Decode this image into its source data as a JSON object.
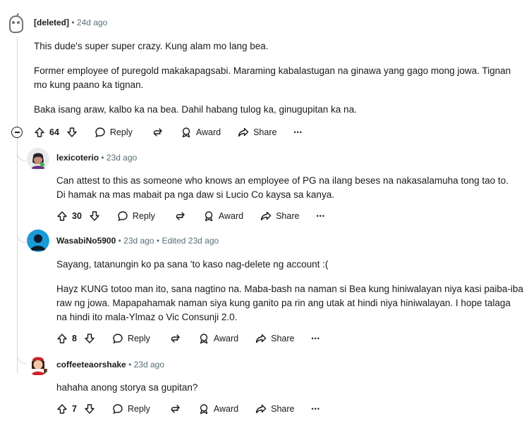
{
  "comments": [
    {
      "username": "[deleted]",
      "time": "24d ago",
      "paragraphs": [
        "This dude's super super crazy. Kung alam mo lang bea.",
        "Former employee of puregold makakapagsabi. Maraming kabalastugan na ginawa yang gago mong jowa. Tignan mo kung paano ka tignan.",
        "Baka isang araw, kalbo ka na bea. Dahil habang tulog ka, ginugupitan ka na."
      ],
      "votes": "64"
    },
    {
      "username": "lexicoterio",
      "time": "23d ago",
      "paragraphs": [
        "Can attest to this as someone who knows an employee of PG na ilang beses na nakasalamuha tong tao to. Di hamak na mas mabait pa nga daw si Lucio Co kaysa sa kanya."
      ],
      "votes": "30"
    },
    {
      "username": "WasabiNo5900",
      "time": "23d ago",
      "edited": "Edited 23d ago",
      "paragraphs": [
        "Sayang, tatanungin ko pa sana 'to kaso nag-delete ng account :(",
        "Hayz KUNG totoo man ito, sana nagtino na. Maba-bash na naman si Bea kung hiniwalayan niya kasi paiba-iba raw ng jowa. Mapapahamak naman siya kung ganito pa rin ang utak at hindi niya hiniwalayan. I hope talaga na hindi ito mala-Ylmaz o Vic Consunji 2.0."
      ],
      "votes": "8"
    },
    {
      "username": "coffeeteaorshake",
      "time": "23d ago",
      "paragraphs": [
        "hahaha anong storya sa gupitan?"
      ],
      "votes": "7"
    }
  ],
  "actions": {
    "reply": "Reply",
    "award": "Award",
    "share": "Share",
    "more": "•••"
  },
  "separator": "•",
  "icons": [
    "upvote-icon",
    "downvote-icon",
    "reply-icon",
    "crosspost-icon",
    "award-icon",
    "share-icon",
    "more-icon",
    "collapse-icon"
  ],
  "colors": {
    "text": "#1a1a1b",
    "meta": "#576f76",
    "thread": "#d4d7d9"
  }
}
